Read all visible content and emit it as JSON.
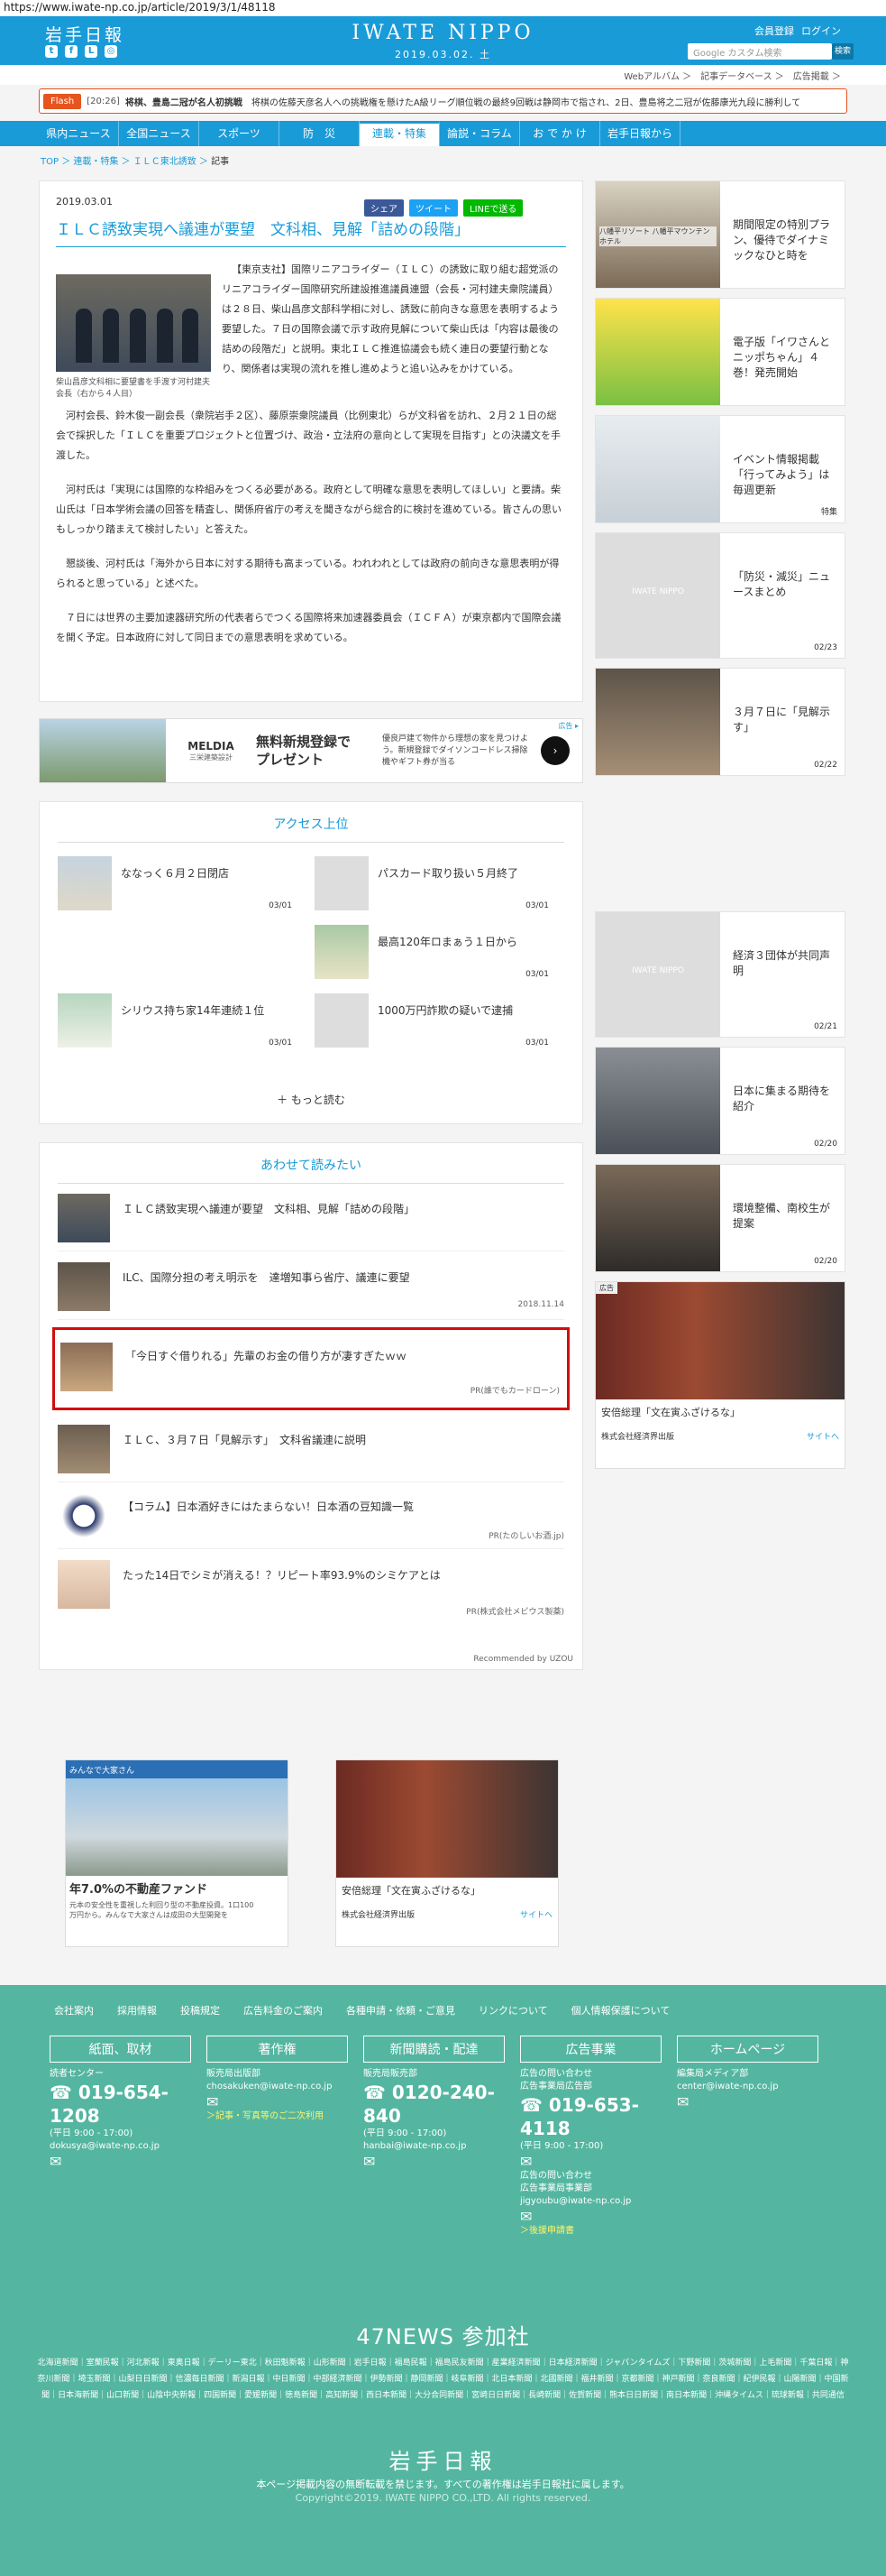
{
  "url": "https://www.iwate-np.co.jp/article/2019/3/1/48118",
  "header": {
    "logo": "岩手日報",
    "masthead": "IWATE NIPPO",
    "date": "2019.03.02. 土",
    "register": "会員登録",
    "login": "ログイン",
    "search_placeholder": "Google カスタム検索",
    "search_btn": "検索"
  },
  "subnav": "Webアルバム ＞　記事データベース ＞　広告掲載 ＞",
  "flash": {
    "tag": "Flash",
    "time": "[20:26]",
    "title": "将棋、豊島二冠が名人初挑戦",
    "text": "将棋の佐藤天彦名人への挑戦権を懸けたA級リーグ順位戦の最終9回戦は静岡市で指され、2日、豊島将之二冠が佐藤康光九段に勝利して"
  },
  "nav": [
    "県内ニュース",
    "全国ニュース",
    "スポーツ",
    "防　災",
    "連載・特集",
    "論説・コラム",
    "お で か け",
    "岩手日報から"
  ],
  "breadcrumb": {
    "top": "TOP",
    "c1": "連載・特集",
    "c2": "ＩＬＣ東北誘致",
    "cur": "記事"
  },
  "article": {
    "date": "2019.03.01",
    "share": [
      "シェア",
      "ツイート",
      "LINEで送る"
    ],
    "title": "ＩＬＣ誘致実現へ議連が要望　文科相、見解「詰めの段階」",
    "caption": "柴山昌彦文科相に要望書を手渡す河村建夫会長（右から４人目）",
    "paragraphs": [
      "【東京支社】国際リニアコライダー（ＩＬＣ）の誘致に取り組む超党派のリニアコライダー国際研究所建設推進議員連盟（会長・河村建夫衆院議員）は２８日、柴山昌彦文部科学相に対し、誘致に前向きな意思を表明するよう要望した。７日の国際会議で示す政府見解について柴山氏は「内容は最後の詰めの段階だ」と説明。東北ＩＬＣ推進協議会も続く連日の要望行動となり、関係者は実現の流れを推し進めようと追い込みをかけている。",
      "河村会長、鈴木俊一副会長（衆院岩手２区）、藤原崇衆院議員（比例東北）らが文科省を訪れ、２月２１日の総会で採択した「ＩＬＣを重要プロジェクトと位置づけ、政治・立法府の意向として実現を目指す」との決議文を手渡した。",
      "河村氏は「実現には国際的な枠組みをつくる必要がある。政府として明確な意思を表明してほしい」と要請。柴山氏は「日本学術会議の回答を精査し、関係府省庁の考えを聞きながら総合的に検討を進めている。皆さんの思いもしっかり踏まえて検討したい」と答えた。",
      "懇談後、河村氏は「海外から日本に対する期待も高まっている。われわれとしては政府の前向きな意思表明が得られると思っている」と述べた。",
      "７日には世界の主要加速器研究所の代表者らでつくる国際将来加速器委員会（ＩＣＦＡ）が東京都内で国際会議を開く予定。日本政府に対して同日までの意思表明を求めている。"
    ]
  },
  "ad": {
    "brand": "MELDIA",
    "brand_sub": "三栄建築設計",
    "headline": "無料新規登録で",
    "headline2": "プレゼント",
    "text": "優良戸建て物件から理想の家を見つけよう。新規登録でダイソンコードレス掃除機やギフト券が当る",
    "badge": "広告 ▸"
  },
  "ranking": {
    "title": "アクセス上位",
    "items": [
      {
        "title": "ななっく６月２日閉店",
        "date": "03/01"
      },
      {
        "title": "パスカード取り扱い５月終了",
        "date": "03/01"
      },
      {
        "title": "最高120年ロまぁう１日から",
        "date": "03/01"
      },
      {
        "title": "シリウス持ち家14年連続１位",
        "date": "03/01"
      },
      {
        "title": "1000万円詐欺の疑いで逮捕",
        "date": "03/01"
      }
    ],
    "more": "もっと読む"
  },
  "related": {
    "title": "あわせて読みたい",
    "items": [
      {
        "title": "ＩＬＣ誘致実現へ議連が要望　文科相、見解「詰めの段階」",
        "meta": ""
      },
      {
        "title": "ILC、国際分担の考え明示を　達増知事ら省庁、議連に要望",
        "meta": "2018.11.14"
      },
      {
        "title": "「今日すぐ借りれる」先輩のお金の借り方が凄すぎたｗｗ",
        "meta": "PR(誰でもカードローン)"
      },
      {
        "title": "ＩＬＣ、３月７日「見解示す」　文科省議連に説明",
        "meta": ""
      },
      {
        "title": "【コラム】日本酒好きにはたまらない！日本酒の豆知識一覧",
        "meta": "PR(たのしいお酒.jp)"
      },
      {
        "title": "たった14日でシミが消える！？リピート率93.9%のシミケアとは",
        "meta": "PR(株式会社メビウス製薬)"
      }
    ],
    "powered": "Recommended by UZOU"
  },
  "ads_bottom": {
    "a1_label": "みんなで大家さん",
    "a1_title": "年7.0%の不動産ファンド",
    "a1_text": "元本の安全性を重視した利回り型の不動産投資。1口100万円から。みんなで大家さんは成田の大型開発を",
    "a2_caption": "安倍総理「文在寅ふざけるな」",
    "a2_sub": "株式会社経済界出版",
    "a2_link": "サイトへ"
  },
  "sidebar": [
    {
      "title": "期間限定の特別プラン、優待でダイナミックなひと時を",
      "date": "",
      "label": "八幡平リゾート 八幡平マウンテンホテル"
    },
    {
      "title": "電子版「イワさんとニッポちゃん」４巻！発売開始",
      "date": ""
    },
    {
      "title": "イベント情報掲載「行ってみよう」は毎週更新",
      "date": "特集"
    },
    {
      "title": "「防災・減災」ニュースまとめ",
      "date": "02/23",
      "logo": "IWATE NIPPO"
    },
    {
      "title": "３月７日に「見解示す」",
      "date": "02/22"
    },
    {
      "title": "経済３団体が共同声明",
      "date": "02/21",
      "logo": "IWATE NIPPO"
    },
    {
      "title": "日本に集まる期待を紹介",
      "date": "02/20"
    },
    {
      "title": "環境整備、南校生が提案",
      "date": "02/20"
    }
  ],
  "side_ad": {
    "label": "広告",
    "caption": "安倍総理「文在寅ふざけるな」",
    "sub": "株式会社経済界出版",
    "link": "サイトへ"
  },
  "footer": {
    "links": [
      "会社案内",
      "採用情報",
      "投稿規定",
      "広告料金のご案内",
      "各種申請・依頼・ご意見",
      "リンクについて",
      "個人情報保護について"
    ],
    "cols": [
      {
        "head": "紙面、取材",
        "l1": "読者センター",
        "tel": "019-654-1208",
        "hours": "(平日 9:00 - 17:00)",
        "mail": "dokusya@iwate-np.co.jp"
      },
      {
        "head": "著作権",
        "l1": "販売局出版部",
        "mail": "chosakuken@iwate-np.co.jp",
        "extra": "＞記事・写真等のご二次利用"
      },
      {
        "head": "新聞購読・配達",
        "l1": "販売局販売部",
        "tel": "0120-240-840",
        "hours": "(平日 9:00 - 17:00)",
        "mail": "hanbai@iwate-np.co.jp"
      },
      {
        "head": "広告事業",
        "l1": "広告の問い合わせ",
        "l2": "広告事業局広告部",
        "tel": "019-653-4118",
        "hours": "(平日 9:00 - 17:00)",
        "l3": "広告の問い合わせ",
        "l4": "広告事業局事業部",
        "mail": "jigyoubu@iwate-np.co.jp",
        "extra": "＞後援申請書"
      },
      {
        "head": "ホームページ",
        "l1": "編集局メディア部",
        "mail": "center@iwate-np.co.jp"
      }
    ],
    "n47": "47NEWS 参加社",
    "papers": "北海道新聞｜室蘭民報｜河北新報｜東奥日報｜デーリー東北｜秋田魁新報｜山形新聞｜岩手日報｜福島民報｜福島民友新聞｜産業経済新聞｜日本経済新聞｜ジャパンタイムズ｜下野新聞｜茨城新聞｜上毛新聞｜千葉日報｜神奈川新聞｜埼玉新聞｜山梨日日新聞｜信濃毎日新聞｜新潟日報｜中日新聞｜中部経済新聞｜伊勢新聞｜静岡新聞｜岐阜新聞｜北日本新聞｜北國新聞｜福井新聞｜京都新聞｜神戸新聞｜奈良新聞｜紀伊民報｜山陽新聞｜中国新聞｜日本海新聞｜山口新聞｜山陰中央新報｜四国新聞｜愛媛新聞｜徳島新聞｜高知新聞｜西日本新聞｜大分合同新聞｜宮崎日日新聞｜長崎新聞｜佐賀新聞｜熊本日日新聞｜南日本新聞｜沖縄タイムス｜琉球新報｜共同通信",
    "logo": "岩手日報",
    "copy1": "本ページ掲載内容の無断転載を禁じます。すべての著作権は岩手日報社に属します。",
    "copy2": "Copyright©2019. IWATE NIPPO CO.,LTD. All rights reserved."
  }
}
